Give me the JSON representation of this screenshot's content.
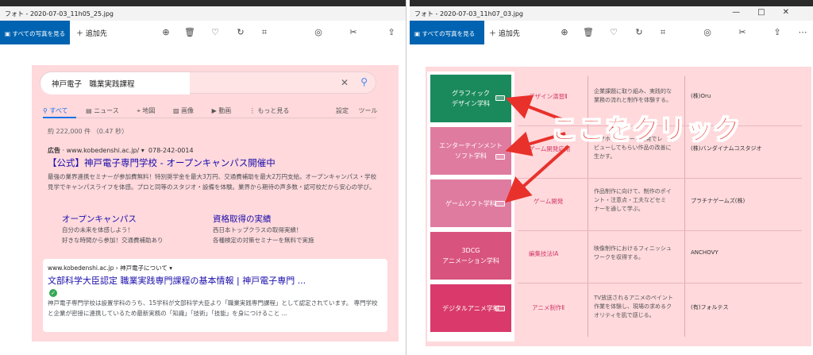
{
  "left_window": {
    "title": "フォト - 2020-07-03_11h05_25.jpg",
    "all_photos": "すべての写真を見る",
    "add_to": "追加先"
  },
  "right_window": {
    "title": "フォト - 2020-07-03_11h07_03.jpg",
    "all_photos": "すべての写真を見る",
    "add_to": "追加先"
  },
  "google": {
    "query": "神戸電子　職業実践課程",
    "tabs": [
      "すべて",
      "ニュース",
      "地図",
      "画像",
      "動画",
      "もっと見る"
    ],
    "settings": "設定",
    "tools": "ツール",
    "result_count": "約 222,000 件 （0.47 秒）",
    "ad": {
      "label": "広告",
      "url": "· www.kobedenshi.ac.jp/ ▾",
      "phone": "078-242-0014",
      "title": "【公式】神戸電子専門学校 - オープンキャンパス開催中",
      "desc": "最強の業界連携セミナーが参加費無料！特別奨学金を最大3万円、交通費補助を最大2万円支給。オープンキャンパス・学校見学でキャンパスライフを体感。プロと同等のスタジオ・設備を体験。業界から期待の声多数・認可校だから安心の学び。",
      "sitelinks": [
        {
          "title": "オープンキャンパス",
          "line1": "自分の未来を体感しよう！",
          "line2": "好きな時間から参加！交通費補助あり"
        },
        {
          "title": "資格取得の実績",
          "line1": "西日本トップクラスの取得実績！",
          "line2": "各種検定の対策セミナーを無料で実施"
        }
      ]
    },
    "organic": {
      "url": "www.kobedenshi.ac.jp › 神戸電子について ▾",
      "title": "文部科学大臣認定 職業実践専門課程の基本情報 | 神戸電子専門 ...",
      "desc": "神戸電子専門学校は設置学科のうち、15学科が文部科学大臣より「職業実践専門課程」として認定されています。 専門学校と企業が密接に連携しているため最新実務の「知識」「技術」「技能」を身につけること ..."
    }
  },
  "table": {
    "rows": [
      {
        "dept": "グラフィック\nデザイン学科",
        "color": "#1a8a5c",
        "subject": "デザイン演習Ⅱ",
        "desc": "企業課題に取り組み、実践的な\n業務の流れと制作を体験する。",
        "company": "(株)Oru"
      },
      {
        "dept": "エンターテインメント\nソフト学科",
        "color": "#e07ba0",
        "subject": "ゲーム開発応用",
        "desc": "スマホや3Dゲーム開発でレ\nビューしてもらい作品の改善に\n生かす。",
        "company": "(株)バンダイナムコスタジオ"
      },
      {
        "dept": "ゲームソフト学科",
        "color": "#e07ba0",
        "subject": "ゲーム開発",
        "desc": "作品制作に向けて、制作のポイ\nント・注意点・工夫などセミ\nナーを通して学ぶ。",
        "company": "プラチナゲームズ(株)"
      },
      {
        "dept": "3DCG\nアニメーション学科",
        "color": "#d9537f",
        "subject": "編集技法ⅠA",
        "desc": "映像制作におけるフィニッシュ\nワークを収得する。",
        "company": "ANCHOVY"
      },
      {
        "dept": "デジタルアニメ学科",
        "color": "#d93a6b",
        "subject": "アニメ制作Ⅱ",
        "desc": "TV放送されるアニメのペイント\n作業を体験し、現場の求めるク\nオリティを肌で感じる。",
        "company": "(有)フォルテス"
      }
    ]
  },
  "callout": "ここをクリック",
  "colors": {
    "accent": "#0063b1",
    "annotation": "#e8312b",
    "highlight": "#ffd9dc"
  }
}
